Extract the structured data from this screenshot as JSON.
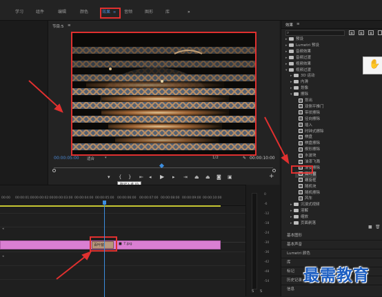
{
  "workspaces": [
    "学习",
    "组件",
    "编辑",
    "颜色",
    "效果",
    "音频",
    "图形",
    "库"
  ],
  "workspace_active_index": 4,
  "workspace_overflow": "»",
  "program_monitor": {
    "title": "节目:5",
    "menu_glyph": "≡",
    "timecode_left": "00:00:05:00",
    "fit_label": "适合",
    "quality_label": "1/2",
    "timecode_right": "00:00:10:00",
    "tooltip": "标记入点 (I)"
  },
  "effects_panel": {
    "title": "效果",
    "menu_glyph": "≡",
    "tree": [
      {
        "label": "预设",
        "type": "folder",
        "depth": 0
      },
      {
        "label": "Lumetri 预设",
        "type": "folder",
        "depth": 0
      },
      {
        "label": "音频效果",
        "type": "folder",
        "depth": 0
      },
      {
        "label": "音频过渡",
        "type": "folder",
        "depth": 0
      },
      {
        "label": "视频效果",
        "type": "folder",
        "depth": 0
      },
      {
        "label": "视频过渡",
        "type": "folder",
        "depth": 0,
        "open": true
      },
      {
        "label": "3D 运动",
        "type": "folder",
        "depth": 1
      },
      {
        "label": "内滑",
        "type": "folder",
        "depth": 1
      },
      {
        "label": "划像",
        "type": "folder",
        "depth": 1
      },
      {
        "label": "擦除",
        "type": "folder",
        "depth": 1,
        "open": true
      },
      {
        "label": "划出",
        "type": "fx",
        "depth": 2
      },
      {
        "label": "双侧平推门",
        "type": "fx",
        "depth": 2
      },
      {
        "label": "带状擦除",
        "type": "fx",
        "depth": 2
      },
      {
        "label": "径向擦除",
        "type": "fx",
        "depth": 2
      },
      {
        "label": "插入",
        "type": "fx",
        "depth": 2
      },
      {
        "label": "时钟式擦除",
        "type": "fx",
        "depth": 2
      },
      {
        "label": "棋盘",
        "type": "fx",
        "depth": 2
      },
      {
        "label": "棋盘擦除",
        "type": "fx",
        "depth": 2
      },
      {
        "label": "楔形擦除",
        "type": "fx",
        "depth": 2
      },
      {
        "label": "水波块",
        "type": "fx",
        "depth": 2
      },
      {
        "label": "油漆飞溅",
        "type": "fx",
        "depth": 2
      },
      {
        "label": "渐变擦除",
        "type": "fx",
        "depth": 2
      },
      {
        "label": "百叶窗",
        "type": "fx",
        "depth": 2,
        "highlighted": true
      },
      {
        "label": "螺旋框",
        "type": "fx",
        "depth": 2
      },
      {
        "label": "随机块",
        "type": "fx",
        "depth": 2
      },
      {
        "label": "随机擦除",
        "type": "fx",
        "depth": 2
      },
      {
        "label": "风车",
        "type": "fx",
        "depth": 2
      },
      {
        "label": "沉浸式视频",
        "type": "folder",
        "depth": 1
      },
      {
        "label": "溶解",
        "type": "folder",
        "depth": 1
      },
      {
        "label": "缩放",
        "type": "folder",
        "depth": 1
      },
      {
        "label": "页面剥落",
        "type": "folder",
        "depth": 1
      }
    ]
  },
  "lower_panels": [
    "基本图形",
    "基本声音",
    "Lumetri 颜色",
    "库",
    "标记",
    "历史记录",
    "信息"
  ],
  "timeline": {
    "ruler": [
      "00:00",
      "00:00:01:00",
      "00:00:02:00",
      "00:00:03:00",
      "00:00:04:00",
      "00:00:05:00",
      "00:00:06:00",
      "00:00:07:00",
      "00:00:08:00",
      "00:00:09:00",
      "00:00:10:00"
    ],
    "clip_transition_label": "百叶窗",
    "clip2_label": "7.jpg"
  },
  "audio_meter": {
    "db_marks": [
      "0",
      "-6",
      "-12",
      "-18",
      "-24",
      "-30",
      "-36",
      "-42",
      "-48",
      "-54"
    ],
    "channel_labels": [
      "S",
      "S"
    ]
  },
  "watermark": "最需教育",
  "colors": {
    "accent_blue": "#4b8ad6",
    "highlight_red": "#e1302f",
    "clip_pink": "#d97fd2",
    "playhead_blue": "#3d8ee0"
  }
}
